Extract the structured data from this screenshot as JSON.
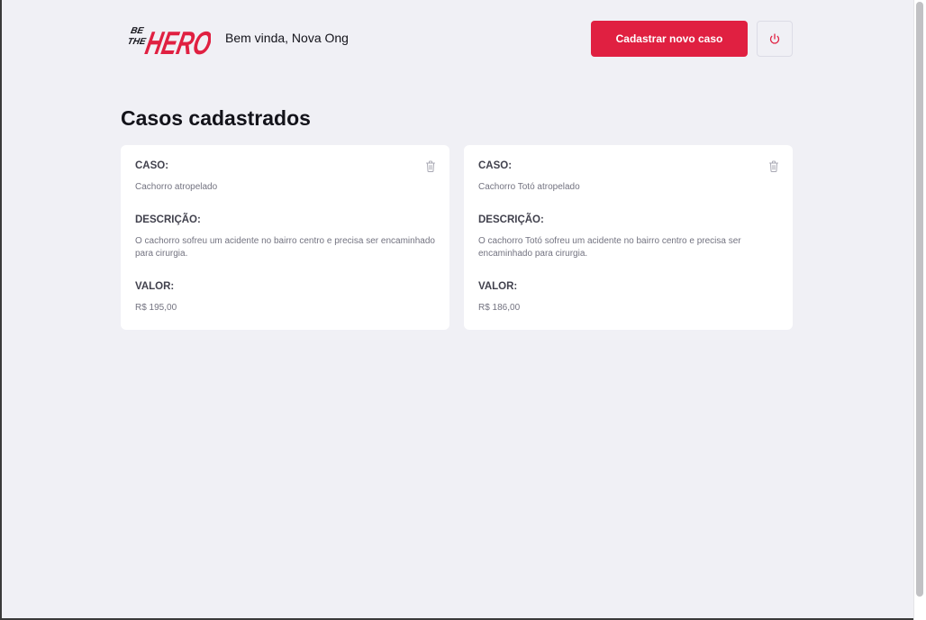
{
  "header": {
    "logo_alt": "Be The Hero",
    "welcome_text": "Bem vinda, Nova Ong",
    "new_case_label": "Cadastrar novo caso",
    "logout_icon": "power-icon"
  },
  "page_title": "Casos cadastrados",
  "labels": {
    "case": "CASO:",
    "description": "DESCRIÇÃO:",
    "value": "VALOR:"
  },
  "cases": [
    {
      "title": "Cachorro atropelado",
      "description": "O cachorro sofreu um acidente no bairro centro e precisa ser encaminhado para cirurgia.",
      "value": "R$ 195,00"
    },
    {
      "title": "Cachorro Totó atropelado",
      "description": "O cachorro Totó sofreu um acidente no bairro centro e precisa ser encaminhado para cirurgia.",
      "value": "R$ 186,00"
    }
  ],
  "colors": {
    "brand": "#e02041",
    "background": "#f0f0f5",
    "card": "#ffffff",
    "label": "#41414d",
    "text_muted": "#737380"
  }
}
